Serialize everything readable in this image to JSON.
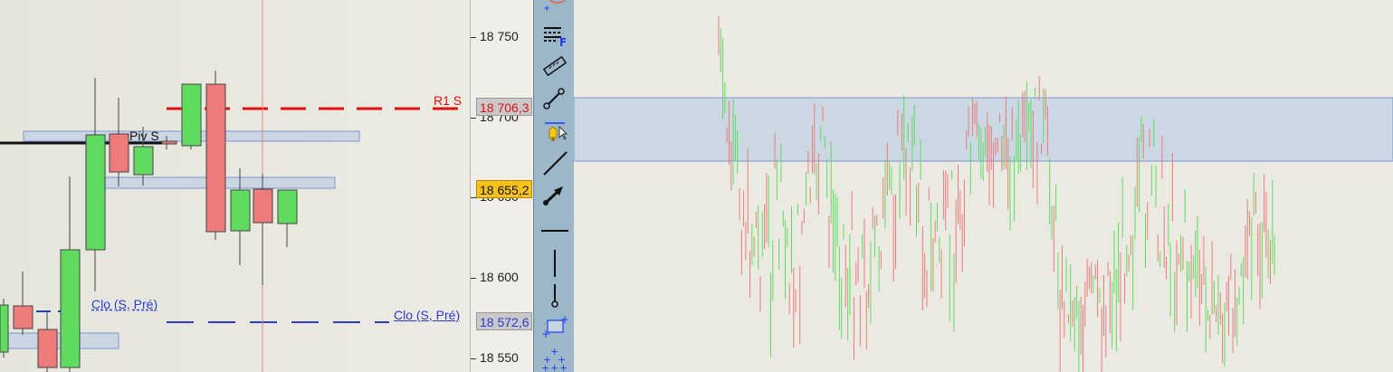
{
  "axis": {
    "ticks": [
      "18 750",
      "18 700",
      "18 650",
      "18 600",
      "18 550"
    ],
    "tag_r1": "18 706,3",
    "tag_current": "18 655,2",
    "tag_clo": "18 572,6"
  },
  "levels": {
    "r1_label": "R1 S",
    "piv_label": "Piv S",
    "clo_label_left": "Clo (S, Pré)",
    "clo_label_right": "Clo (S, Pré)"
  },
  "colors": {
    "bull": "#5fdc5f",
    "bear": "#ee7a7a",
    "resistance": "#e01010",
    "close_line": "#2a3bd8",
    "zone_fill": "#c8d5e4",
    "zone_stroke": "#6f8ed8",
    "tag_r1_bg": "#c9c9c9",
    "tag_current_bg": "#f6c21a",
    "tag_clo_bg": "#c9c9c9",
    "toolbar_bg": "#9cb8c8"
  },
  "toolbar": {
    "tools": [
      "ellipse-tool-icon",
      "fibonacci-tool-icon",
      "ruler-tool-icon",
      "segment-tool-icon",
      "alert-tool-icon",
      "trendline-tool-icon",
      "arrow-tool-icon",
      "horizontal-line-tool-icon",
      "vertical-line-tool-icon",
      "vertical-segment-tool-icon",
      "rectangle-tool-icon",
      "points-tool-icon"
    ]
  }
}
